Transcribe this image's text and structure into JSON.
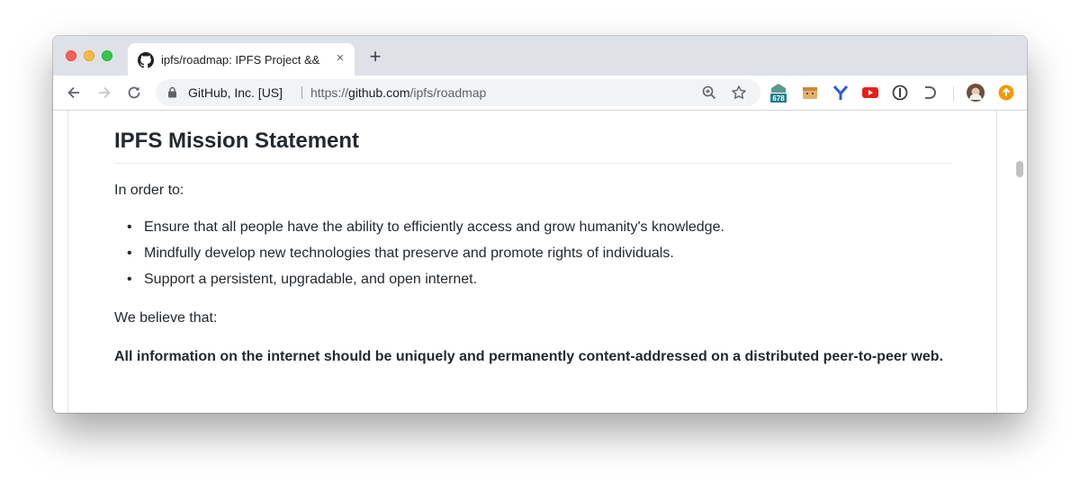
{
  "browser": {
    "tab_title": "ipfs/roadmap: IPFS Project &&",
    "tab_close": "×",
    "new_tab": "+",
    "address": {
      "org": "GitHub, Inc. [US]",
      "url_prefix": "https://",
      "url_host": "github.com",
      "url_path": "/ipfs/roadmap"
    },
    "extensions": [
      "badge-678-extension",
      "box-extension",
      "y-extension",
      "video-extension",
      "onepassword-extension",
      "d-extension"
    ],
    "extension_badge": "678"
  },
  "page": {
    "heading": "IPFS Mission Statement",
    "intro": "In order to:",
    "bullets": [
      "Ensure that all people have the ability to efficiently access and grow humanity's knowledge.",
      "Mindfully develop new technologies that preserve and promote rights of individuals.",
      "Support a persistent, upgradable, and open internet."
    ],
    "belief_intro": "We believe that:",
    "belief": "All information on the internet should be uniquely and permanently content-addressed on a distributed peer-to-peer web."
  },
  "colors": {
    "tabstrip": "#dee1e6",
    "omnibox": "#f1f3f4",
    "text": "#24292e"
  }
}
